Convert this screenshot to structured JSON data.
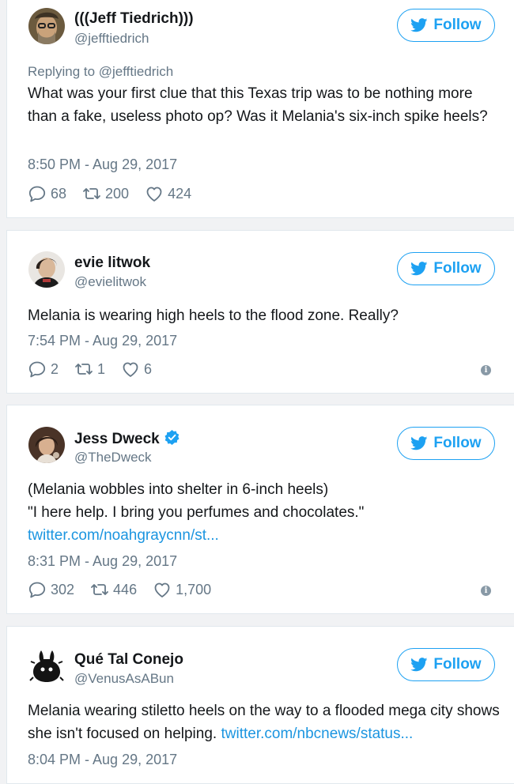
{
  "follow_label": "Follow",
  "colors": {
    "accent": "#1da1f2",
    "link": "#1b95e0",
    "muted": "#657786"
  },
  "tweets": [
    {
      "name": "(((Jeff Tiedrich)))",
      "handle": "@jefftiedrich",
      "reply_to": "Replying to @jefftiedrich",
      "text": "What was your first clue that this Texas trip was to be nothing more than a fake, useless photo op? Was it Melania's six-inch spike heels?",
      "time": "8:50 PM - Aug 29, 2017",
      "replies": "68",
      "retweets": "200",
      "likes": "424"
    },
    {
      "name": "evie litwok",
      "handle": "@evielitwok",
      "text": "Melania is wearing high heels to the flood zone. Really?",
      "time": "7:54 PM - Aug 29, 2017",
      "replies": "2",
      "retweets": "1",
      "likes": "6"
    },
    {
      "name": "Jess Dweck",
      "handle": "@TheDweck",
      "verified": true,
      "text_line1": "(Melania wobbles into shelter in 6-inch heels)",
      "text_line2": "\"I here help. I bring you perfumes and chocolates.\"",
      "link": "twitter.com/noahgraycnn/st...",
      "time": "8:31 PM - Aug 29, 2017",
      "replies": "302",
      "retweets": "446",
      "likes": "1,700"
    },
    {
      "name": "Qué Tal Conejo",
      "handle": "@VenusAsABun",
      "text": "Melania wearing stiletto heels on the way to a flooded mega city shows she isn't focused on helping.",
      "link": "twitter.com/nbcnews/status...",
      "time": "8:04 PM - Aug 29, 2017"
    }
  ],
  "icons": [
    "twitter-bird-icon",
    "reply-icon",
    "retweet-icon",
    "like-icon",
    "info-icon",
    "verified-badge-icon"
  ]
}
